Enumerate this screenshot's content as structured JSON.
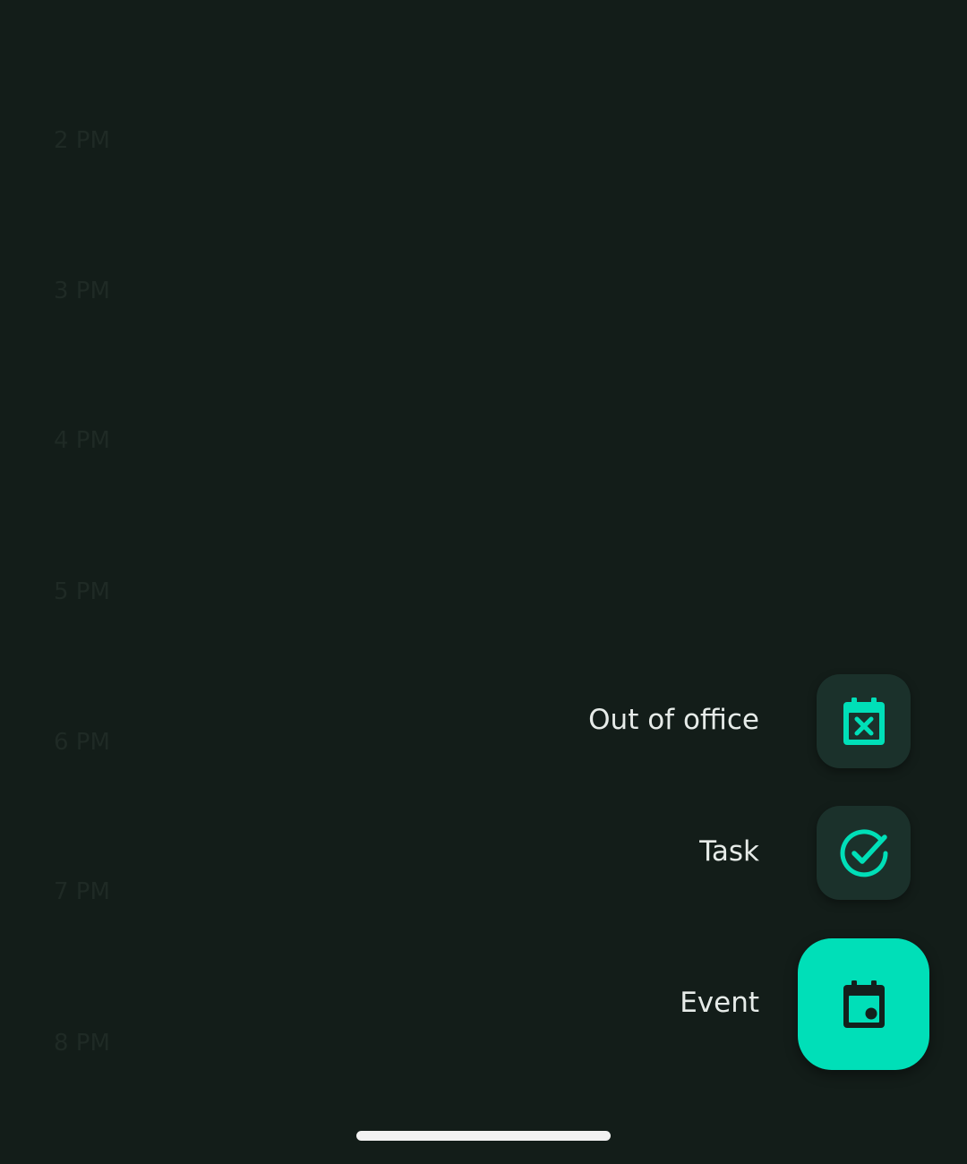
{
  "timeline": {
    "hours": [
      "2 PM",
      "3 PM",
      "4 PM",
      "5 PM",
      "6 PM",
      "7 PM",
      "8 PM"
    ]
  },
  "fab_menu": {
    "out_of_office": {
      "label": "Out of office",
      "icon": "calendar-x-icon"
    },
    "task": {
      "label": "Task",
      "icon": "check-circle-icon"
    },
    "event": {
      "label": "Event",
      "icon": "calendar-event-icon"
    }
  },
  "colors": {
    "background": "#131d19",
    "accent": "#00dfb8",
    "mini_fab_bg": "#1b312b",
    "label_text": "#e6ebe8",
    "home_indicator": "#f2f2f2"
  }
}
